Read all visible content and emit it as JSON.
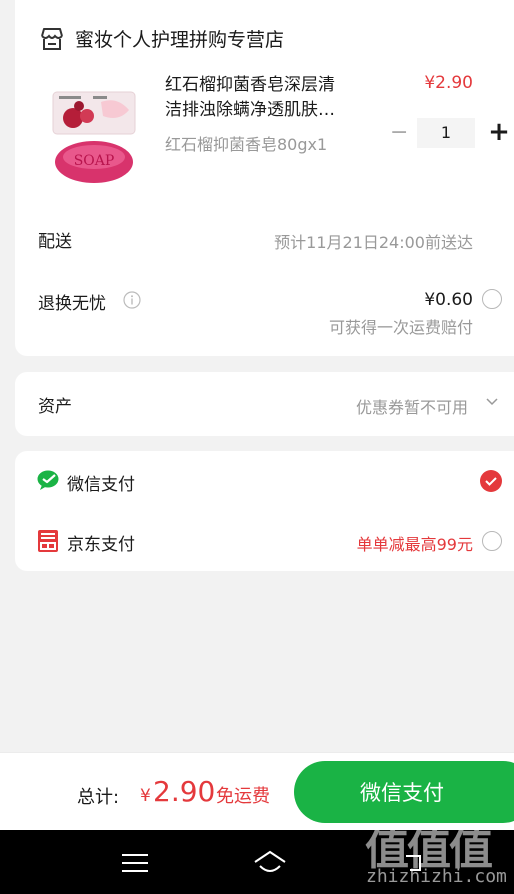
{
  "store": {
    "name": "蜜妆个人护理拼购专营店",
    "icon": "store-icon"
  },
  "product": {
    "title_line1": "红石榴抑菌香皂深层清",
    "title_line2": "洁排浊除螨净透肌肤…",
    "price": "¥2.90",
    "spec": "红石榴抑菌香皂80gx1",
    "quantity": "1",
    "minus": "−",
    "plus": "+",
    "image_text": "SOAP"
  },
  "delivery": {
    "label": "配送",
    "value": "预计11月21日24:00前送达"
  },
  "return_insurance": {
    "label": "退换无忧",
    "price": "¥0.60",
    "note": "可获得一次运费赔付",
    "selected": false
  },
  "assets": {
    "label": "资产",
    "value": "优惠券暂不可用"
  },
  "payment": {
    "options": [
      {
        "label": "微信支付",
        "icon": "wechat-pay-icon",
        "selected": true,
        "promo": ""
      },
      {
        "label": "京东支付",
        "icon": "jd-pay-icon",
        "selected": false,
        "promo": "单单减最高99元"
      }
    ]
  },
  "footer": {
    "total_label": "总计:",
    "currency": "¥",
    "amount": "2.90",
    "shipping": "免运费",
    "pay_button": "微信支付"
  },
  "watermark": {
    "text": "值值值",
    "url": "zhizhizhi.com"
  },
  "colors": {
    "accent": "#e4393c",
    "wechat_green": "#1ab345",
    "background": "#f2f2f2"
  }
}
